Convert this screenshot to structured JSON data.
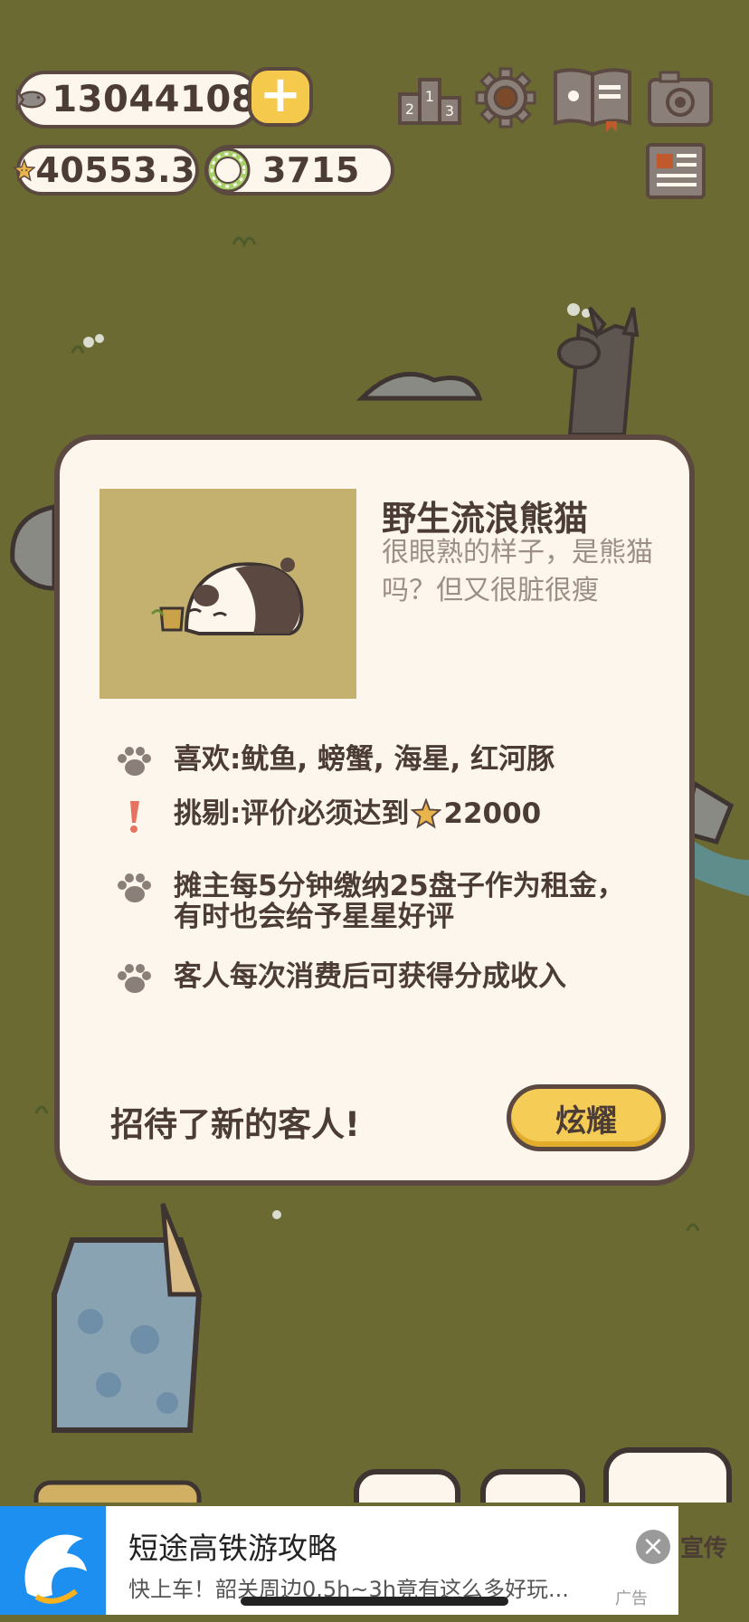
{
  "resources": {
    "fish": "13044108",
    "stars": "40553.3",
    "coins": "3715"
  },
  "customer": {
    "name": "野生流浪熊猫",
    "description": "很眼熟的样子，是熊猫吗？但又很脏很瘦",
    "traits": [
      {
        "icon": "paw-icon",
        "text": "喜欢:鱿鱼, 螃蟹, 海星, 红河豚"
      },
      {
        "icon": "exclamation-icon",
        "text_before": "挑剔:评价必须达到",
        "text_after": "22000"
      },
      {
        "icon": "paw-icon",
        "text": "摊主每5分钟缴纳25盘子作为租金，有时也会给予星星好评"
      },
      {
        "icon": "paw-icon",
        "text": "客人每次消费后可获得分成收入"
      }
    ]
  },
  "welcome_text": "招待了新的客人!",
  "show_button": "炫耀",
  "partial_button": "宣传",
  "ad": {
    "title": "短途高铁游攻略",
    "subtitle": "快上车！韶关周边0.5h~3h竟有这么多好玩...",
    "tag": "广告"
  },
  "colors": {
    "background": "#6b6a33",
    "panel": "#fdf6ec",
    "outline": "#5a4841",
    "button": "#f5cc55"
  }
}
